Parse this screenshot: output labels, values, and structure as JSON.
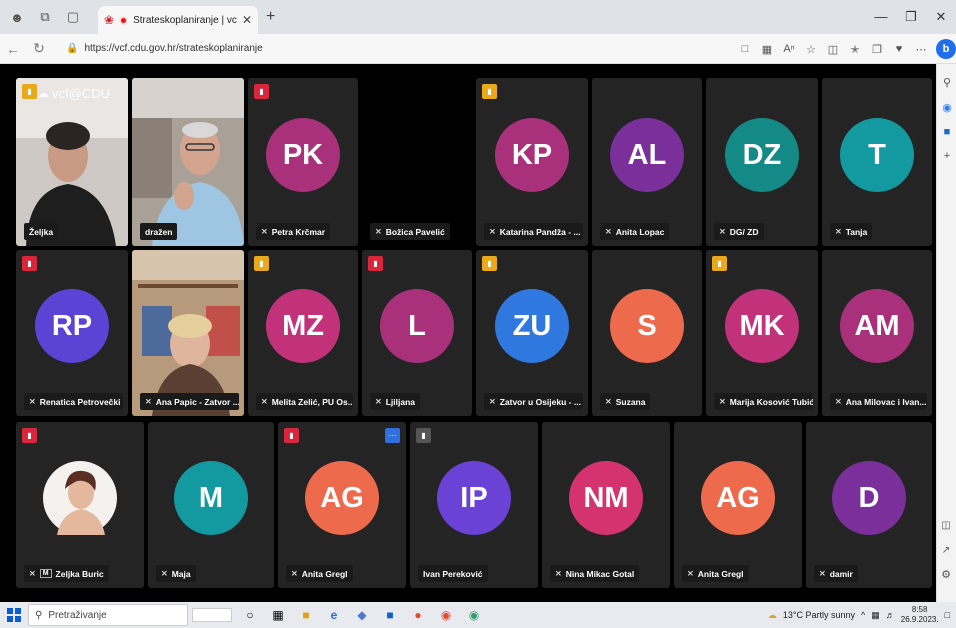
{
  "browser": {
    "tab_title": "Strateskoplaniranje | vcf@C",
    "url": "https://vcf.cdu.gov.hr/strateskoplaniranje"
  },
  "watermark": "vcf@CDU",
  "participants": [
    {
      "name": "Željka",
      "type": "video",
      "badge": "yellow"
    },
    {
      "name": "dražen",
      "type": "video"
    },
    {
      "name": "Petra Krčmar",
      "initials": "PK",
      "color": "#a9317c",
      "badge": "red"
    },
    {
      "name": "Božica Pavelić",
      "type": "black"
    },
    {
      "name": "Katarina Pandža - ...",
      "initials": "KP",
      "color": "#a9317c",
      "badge": "yellow"
    },
    {
      "name": "Anita Lopac",
      "initials": "AL",
      "color": "#7a2f9a"
    },
    {
      "name": "DG/ ZD",
      "initials": "DZ",
      "color": "#138a86"
    },
    {
      "name": "Tanja",
      "initials": "T",
      "color": "#139aa0"
    },
    {
      "name": "Renatica Petrovečki",
      "initials": "RP",
      "color": "#5b43d6",
      "badge": "red"
    },
    {
      "name": "Ana Papic - Zatvor ...",
      "type": "video"
    },
    {
      "name": "Melita Zelić, PU Os...",
      "initials": "MZ",
      "color": "#c2327a",
      "badge": "yellow"
    },
    {
      "name": "Ljiljana",
      "initials": "L",
      "color": "#a9317c",
      "badge": "red"
    },
    {
      "name": "Zatvor u Osijeku - ...",
      "initials": "ZU",
      "color": "#2e78e0",
      "badge": "yellow"
    },
    {
      "name": "Suzana",
      "initials": "S",
      "color": "#ee6a4d"
    },
    {
      "name": "Marija Kosović Tubić",
      "initials": "MK",
      "color": "#c2327a",
      "badge": "yellow"
    },
    {
      "name": "Ana Milovac i Ivan...",
      "initials": "AM",
      "color": "#a9317c"
    },
    {
      "name": "Zeljka Buric",
      "type": "photo",
      "badge": "red"
    },
    {
      "name": "Maja",
      "initials": "M",
      "color": "#139aa0"
    },
    {
      "name": "Anita Gregl",
      "initials": "AG",
      "color": "#ee6a4d",
      "badge": "red"
    },
    {
      "name": "Ivan Pereković",
      "initials": "IP",
      "color": "#6a43d6",
      "badge": "gray"
    },
    {
      "name": "Nina Mikac Gotal",
      "initials": "NM",
      "color": "#d5336f"
    },
    {
      "name": "Anita Gregl",
      "initials": "AG",
      "color": "#ee6a4d"
    },
    {
      "name": "damir",
      "initials": "D",
      "color": "#7a2f9a"
    }
  ],
  "taskbar": {
    "search_placeholder": "Pretraživanje",
    "weather": "13°C  Partly sunny",
    "time": "8:58",
    "date": "26.9.2023."
  }
}
